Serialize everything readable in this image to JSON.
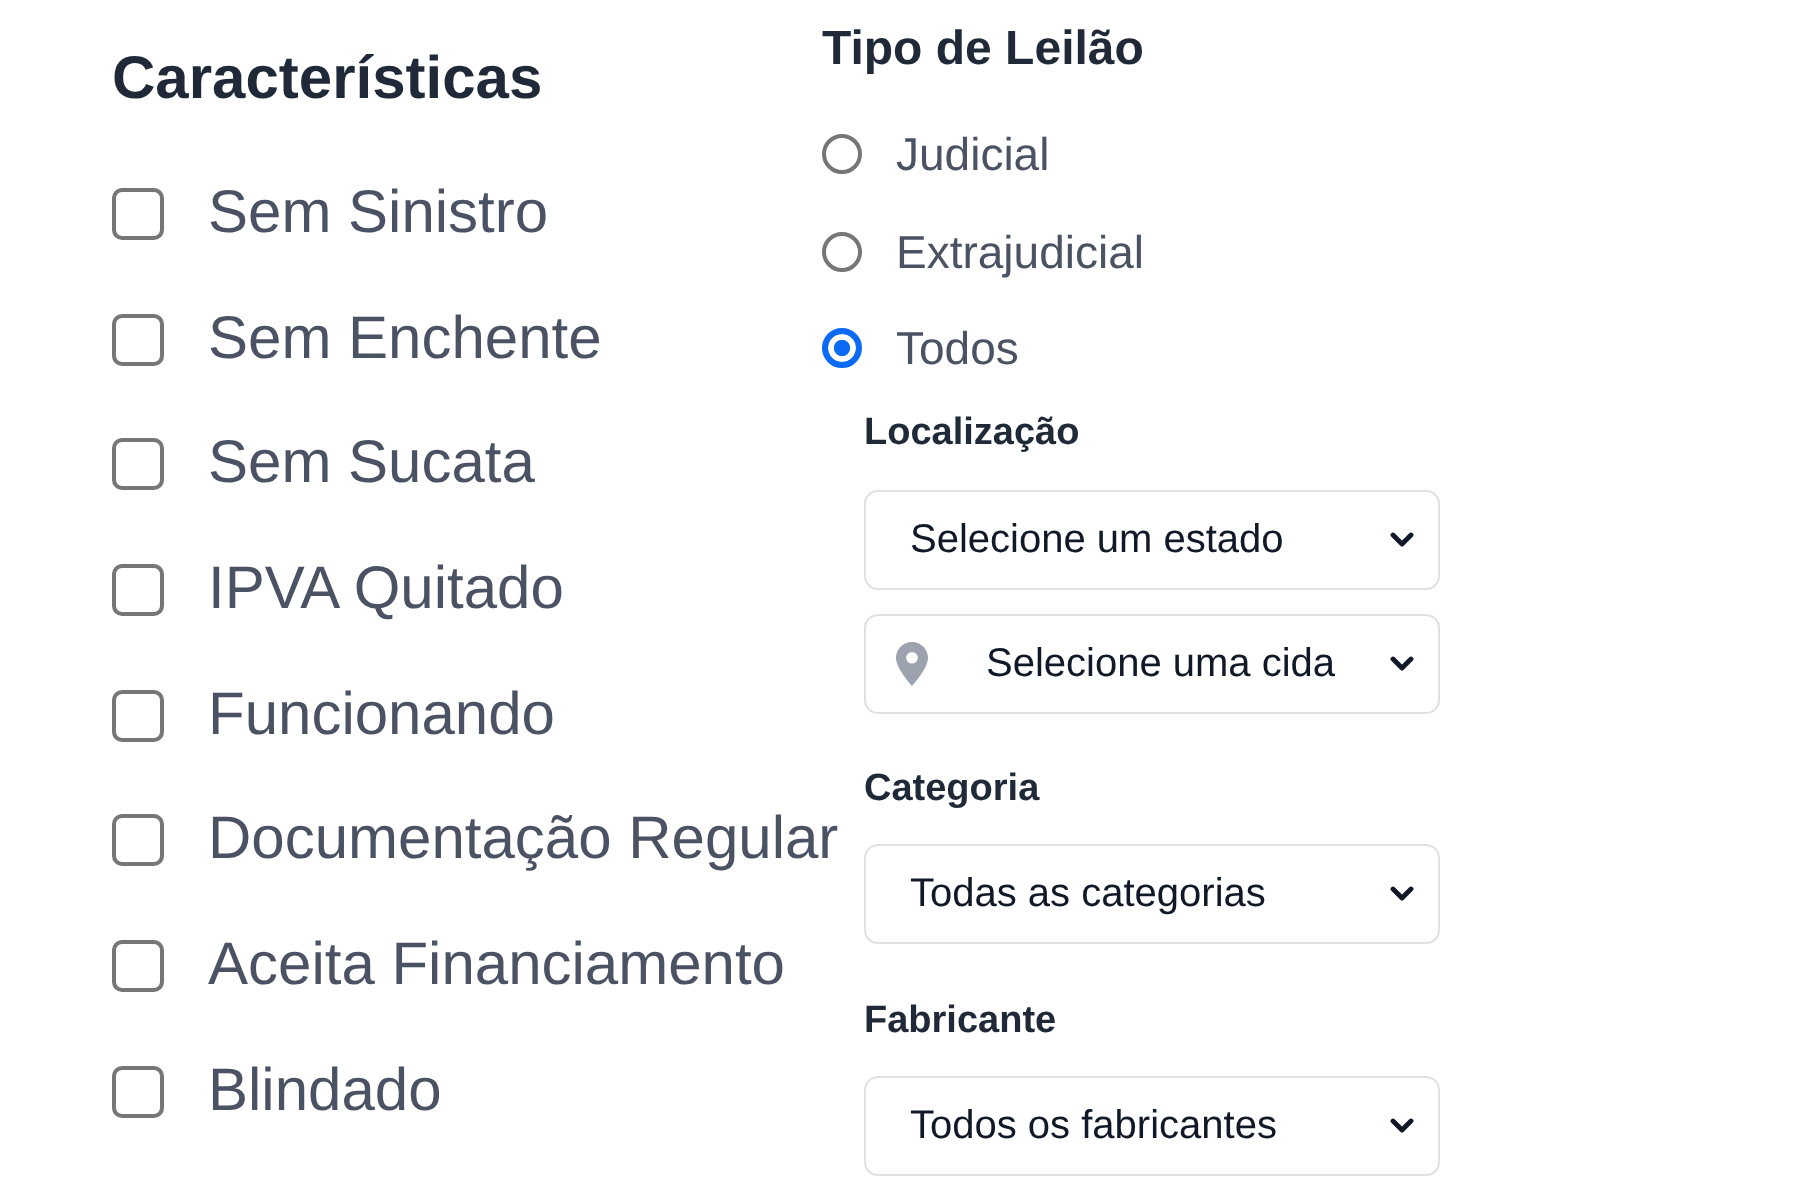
{
  "features": {
    "title": "Características",
    "options": [
      {
        "label": "Sem Sinistro",
        "checked": false
      },
      {
        "label": "Sem Enchente",
        "checked": false
      },
      {
        "label": "Sem Sucata",
        "checked": false
      },
      {
        "label": "IPVA Quitado",
        "checked": false
      },
      {
        "label": "Funcionando",
        "checked": false
      },
      {
        "label": "Documentação Regular",
        "checked": false
      },
      {
        "label": "Aceita Financiamento",
        "checked": false
      },
      {
        "label": "Blindado",
        "checked": false
      }
    ]
  },
  "auction_type": {
    "title": "Tipo de Leilão",
    "options": [
      {
        "label": "Judicial",
        "selected": false
      },
      {
        "label": "Extrajudicial",
        "selected": false
      },
      {
        "label": "Todos",
        "selected": true
      }
    ]
  },
  "location": {
    "label": "Localização",
    "state_select": {
      "value": "Selecione um estado"
    },
    "city_select": {
      "value": "Selecione uma cida"
    }
  },
  "category": {
    "label": "Categoria",
    "value": "Todas as categorias"
  },
  "manufacturer": {
    "label": "Fabricante",
    "value": "Todos os fabricantes"
  }
}
